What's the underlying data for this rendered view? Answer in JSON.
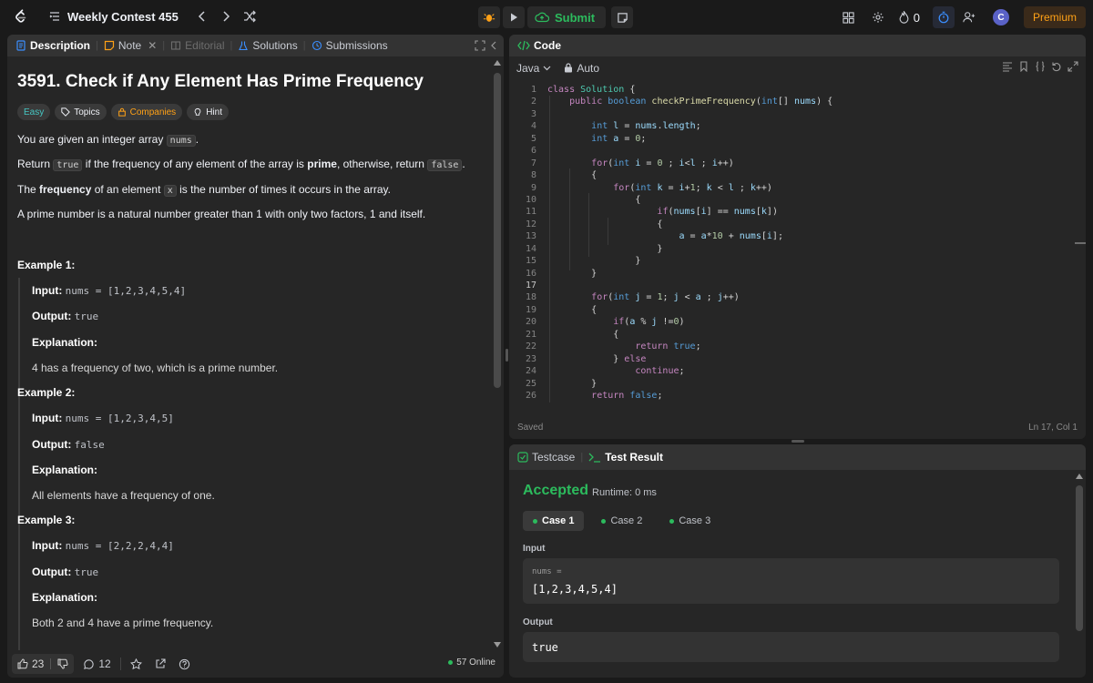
{
  "topbar": {
    "title": "Weekly Contest 455",
    "submit_label": "Submit",
    "streak_count": "0",
    "avatar_initial": "C",
    "premium_label": "Premium"
  },
  "left": {
    "tabs": [
      "Description",
      "Note",
      "Editorial",
      "Solutions",
      "Submissions"
    ],
    "title": "3591. Check if Any Element Has Prime Frequency",
    "badges": [
      "Easy",
      "Topics",
      "Companies",
      "Hint"
    ],
    "p1_pre": "You are given an integer array ",
    "p1_code": "nums",
    "p1_post": ".",
    "p2_pre": "Return ",
    "p2_code1": "true",
    "p2_mid1": " if the frequency of any element of the array is ",
    "p2_bold": "prime",
    "p2_mid2": ", otherwise, return ",
    "p2_code2": "false",
    "p2_post": ".",
    "p3_pre": "The ",
    "p3_bold": "frequency",
    "p3_mid": " of an element ",
    "p3_code": "x",
    "p3_post": " is the number of times it occurs in the array.",
    "p4": "A prime number is a natural number greater than 1 with only two factors, 1 and itself.",
    "examples": [
      {
        "heading": "Example 1:",
        "input_label": "Input:",
        "input": "nums = [1,2,3,4,5,4]",
        "output_label": "Output:",
        "output": "true",
        "expl_label": "Explanation:",
        "explanation": "4 has a frequency of two, which is a prime number."
      },
      {
        "heading": "Example 2:",
        "input_label": "Input:",
        "input": "nums = [1,2,3,4,5]",
        "output_label": "Output:",
        "output": "false",
        "expl_label": "Explanation:",
        "explanation": "All elements have a frequency of one."
      },
      {
        "heading": "Example 3:",
        "input_label": "Input:",
        "input": "nums = [2,2,2,4,4]",
        "output_label": "Output:",
        "output": "true",
        "expl_label": "Explanation:",
        "explanation": "Both 2 and 4 have a prime frequency."
      }
    ],
    "footer": {
      "likes": "23",
      "comments": "12",
      "online": "57 Online"
    }
  },
  "code": {
    "tab": "Code",
    "language": "Java",
    "mode": "Auto",
    "status": "Saved",
    "cursor": "Ln 17, Col 1",
    "current_line": 17,
    "lines": [
      [
        [
          "kw",
          "class "
        ],
        [
          "cl",
          "Solution "
        ],
        [
          "",
          "{"
        ]
      ],
      [
        [
          "",
          "    "
        ],
        [
          "kw",
          "public "
        ],
        [
          "ty",
          "boolean "
        ],
        [
          "fn",
          "checkPrimeFrequency"
        ],
        [
          "",
          "("
        ],
        [
          "ty",
          "int"
        ],
        [
          "",
          "[] "
        ],
        [
          "va",
          "nums"
        ],
        [
          "",
          ") {"
        ]
      ],
      [],
      [
        [
          "",
          "        "
        ],
        [
          "ty",
          "int "
        ],
        [
          "va",
          "l "
        ],
        [
          "",
          "= "
        ],
        [
          "va",
          "nums"
        ],
        [
          "",
          "."
        ],
        [
          "va",
          "length"
        ],
        [
          "",
          ";"
        ]
      ],
      [
        [
          "",
          "        "
        ],
        [
          "ty",
          "int "
        ],
        [
          "va",
          "a "
        ],
        [
          "",
          "= "
        ],
        [
          "nu",
          "0"
        ],
        [
          "",
          ";"
        ]
      ],
      [],
      [
        [
          "",
          "        "
        ],
        [
          "kw",
          "for"
        ],
        [
          "",
          "("
        ],
        [
          "ty",
          "int "
        ],
        [
          "va",
          "i "
        ],
        [
          "",
          "= "
        ],
        [
          "nu",
          "0 "
        ],
        [
          "",
          "; "
        ],
        [
          "va",
          "i"
        ],
        [
          "",
          "<"
        ],
        [
          "va",
          "l "
        ],
        [
          "",
          "; "
        ],
        [
          "va",
          "i"
        ],
        [
          "",
          "++)"
        ]
      ],
      [
        [
          "",
          "        {"
        ]
      ],
      [
        [
          "",
          "            "
        ],
        [
          "kw",
          "for"
        ],
        [
          "",
          "("
        ],
        [
          "ty",
          "int "
        ],
        [
          "va",
          "k "
        ],
        [
          "",
          "= "
        ],
        [
          "va",
          "i"
        ],
        [
          "",
          "+"
        ],
        [
          "nu",
          "1"
        ],
        [
          "",
          "; "
        ],
        [
          "va",
          "k "
        ],
        [
          "",
          "< "
        ],
        [
          "va",
          "l "
        ],
        [
          "",
          "; "
        ],
        [
          "va",
          "k"
        ],
        [
          "",
          "++)"
        ]
      ],
      [
        [
          "",
          "                {"
        ]
      ],
      [
        [
          "",
          "                    "
        ],
        [
          "kw",
          "if"
        ],
        [
          "",
          "("
        ],
        [
          "va",
          "nums"
        ],
        [
          "",
          "["
        ],
        [
          "va",
          "i"
        ],
        [
          "",
          "] == "
        ],
        [
          "va",
          "nums"
        ],
        [
          "",
          "["
        ],
        [
          "va",
          "k"
        ],
        [
          "",
          "])"
        ]
      ],
      [
        [
          "",
          "                    {"
        ]
      ],
      [
        [
          "",
          "                        "
        ],
        [
          "va",
          "a "
        ],
        [
          "",
          "= "
        ],
        [
          "va",
          "a"
        ],
        [
          "",
          "*"
        ],
        [
          "nu",
          "10 "
        ],
        [
          "",
          "+ "
        ],
        [
          "va",
          "nums"
        ],
        [
          "",
          "["
        ],
        [
          "va",
          "i"
        ],
        [
          "",
          "];"
        ]
      ],
      [
        [
          "",
          "                    }"
        ]
      ],
      [
        [
          "",
          "                }"
        ]
      ],
      [
        [
          "",
          "        }"
        ]
      ],
      [],
      [
        [
          "",
          "        "
        ],
        [
          "kw",
          "for"
        ],
        [
          "",
          "("
        ],
        [
          "ty",
          "int "
        ],
        [
          "va",
          "j "
        ],
        [
          "",
          "= "
        ],
        [
          "nu",
          "1"
        ],
        [
          "",
          "; "
        ],
        [
          "va",
          "j "
        ],
        [
          "",
          "< "
        ],
        [
          "va",
          "a "
        ],
        [
          "",
          "; "
        ],
        [
          "va",
          "j"
        ],
        [
          "",
          "++)"
        ]
      ],
      [
        [
          "",
          "        {"
        ]
      ],
      [
        [
          "",
          "            "
        ],
        [
          "kw",
          "if"
        ],
        [
          "",
          "("
        ],
        [
          "va",
          "a "
        ],
        [
          "",
          "% "
        ],
        [
          "va",
          "j "
        ],
        [
          "",
          "!="
        ],
        [
          "nu",
          "0"
        ],
        [
          "",
          ")"
        ]
      ],
      [
        [
          "",
          "            {"
        ]
      ],
      [
        [
          "",
          "                "
        ],
        [
          "kw",
          "return "
        ],
        [
          "ty",
          "true"
        ],
        [
          "",
          ";"
        ]
      ],
      [
        [
          "",
          "            } "
        ],
        [
          "kw",
          "else"
        ]
      ],
      [
        [
          "",
          "                "
        ],
        [
          "kw",
          "continue"
        ],
        [
          "",
          ";"
        ]
      ],
      [
        [
          "",
          "        }"
        ]
      ],
      [
        [
          "",
          "        "
        ],
        [
          "kw",
          "return "
        ],
        [
          "ty",
          "false"
        ],
        [
          "",
          ";"
        ]
      ]
    ]
  },
  "test": {
    "tabs": [
      "Testcase",
      "Test Result"
    ],
    "status": "Accepted",
    "runtime": "Runtime: 0 ms",
    "cases": [
      "Case 1",
      "Case 2",
      "Case 3"
    ],
    "input_label": "Input",
    "input_name": "nums =",
    "input_value": "[1,2,3,4,5,4]",
    "output_label": "Output",
    "output_value": "true"
  }
}
